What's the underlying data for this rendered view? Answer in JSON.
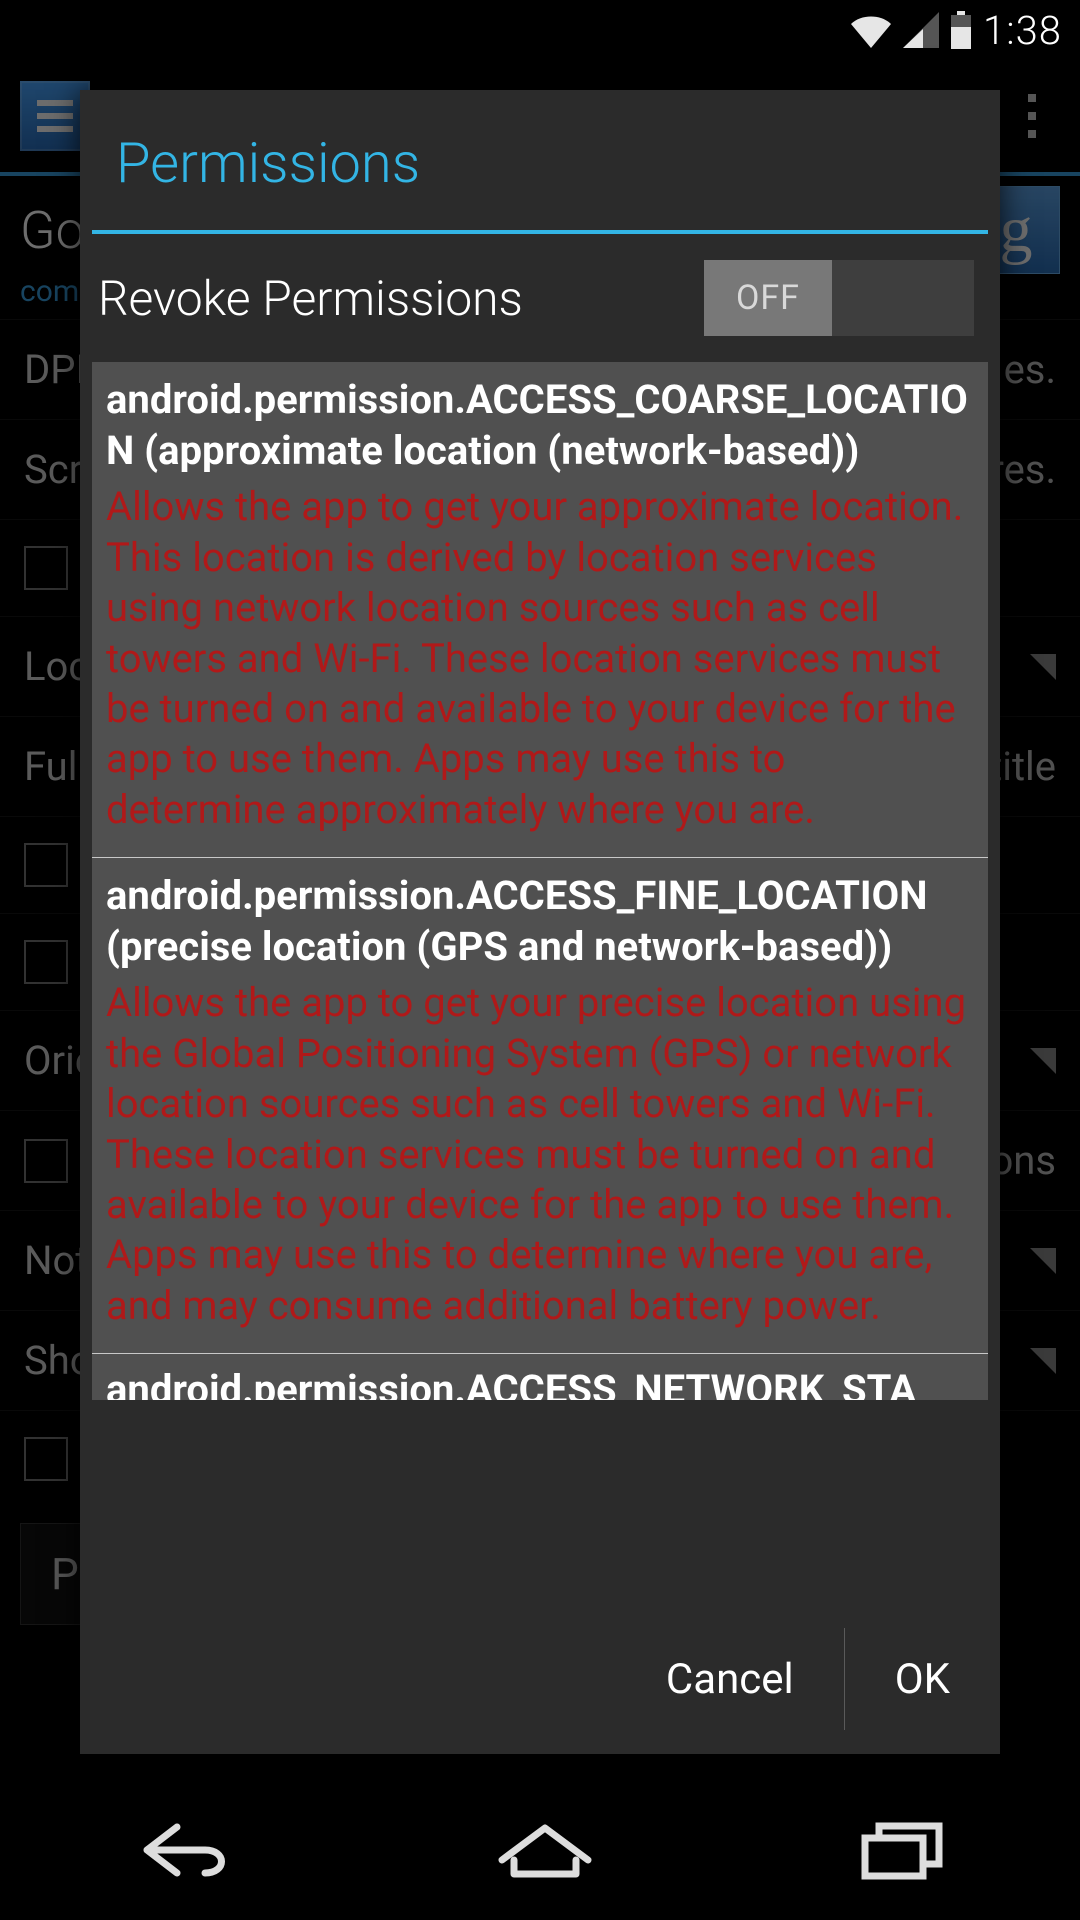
{
  "status": {
    "time": "1:38"
  },
  "background": {
    "title": "Go",
    "subtitle": "com",
    "g_icon": "g",
    "rows": {
      "dpi": "DPI",
      "dpi_right": "es.",
      "scr": "Scre",
      "scr_right": "res.",
      "loca": "Loca",
      "fulls": "Fulls",
      "fulls_right": "title",
      "ori": "Orie",
      "ori_right": "ons",
      "noti": "Notif",
      "show": "Show"
    },
    "pe_button": "Pe"
  },
  "dialog": {
    "title": "Permissions",
    "revoke_label": "Revoke Permissions",
    "toggle_state": "OFF",
    "permissions": [
      {
        "name": "android.permission.ACCESS_COARSE_LOCATION (approximate location (network-based))",
        "description": "Allows the app to get your approximate location. This location is derived by location services using network location sources such as cell towers and Wi-Fi. These location services must be turned on and available to your device for the app to use them. Apps may use this to determine approximately where you are."
      },
      {
        "name": "android.permission.ACCESS_FINE_LOCATION (precise location (GPS and network-based))",
        "description": "Allows the app to get your precise location using the Global Positioning System (GPS) or network location sources such as cell towers and Wi-Fi. These location services must be turned on and available to your device for the app to use them. Apps may use this to determine where you are, and may consume additional battery power."
      }
    ],
    "cutoff_name": "android.permission.ACCESS_NETWORK_STA",
    "cancel": "Cancel",
    "ok": "OK"
  }
}
